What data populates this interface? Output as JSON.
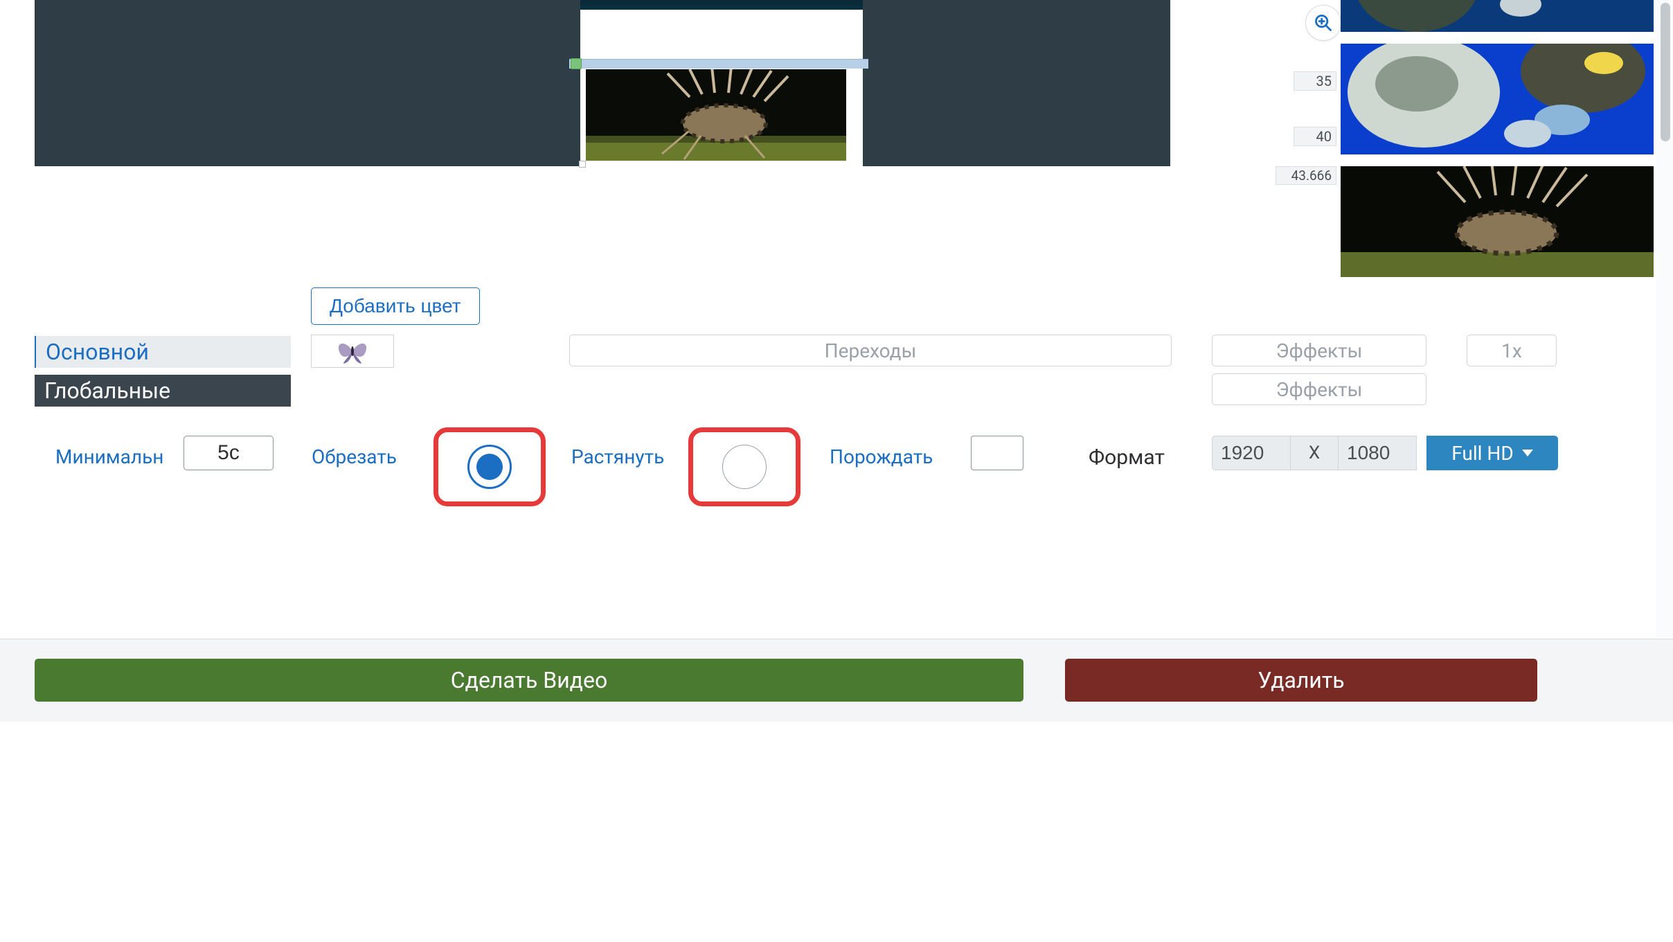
{
  "timeline": {
    "tick35": "35",
    "tick40": "40",
    "tick43": "43.666"
  },
  "controls": {
    "addColor": "Добавить цвет",
    "tabMain": "Основной",
    "tabGlobal": "Глобальные",
    "transitions": "Переходы",
    "effects": "Эффекты",
    "speed": "1x"
  },
  "row2": {
    "minLabel": "Минимальн",
    "minValue": "5с",
    "cropLabel": "Обрезать",
    "stretchLabel": "Растянуть",
    "waitLabel": "Порождать",
    "formatLabel": "Формат",
    "width": "1920",
    "x": "X",
    "height": "1080",
    "preset": "Full HD"
  },
  "bottom": {
    "make": "Сделать Видео",
    "delete": "Удалить"
  }
}
